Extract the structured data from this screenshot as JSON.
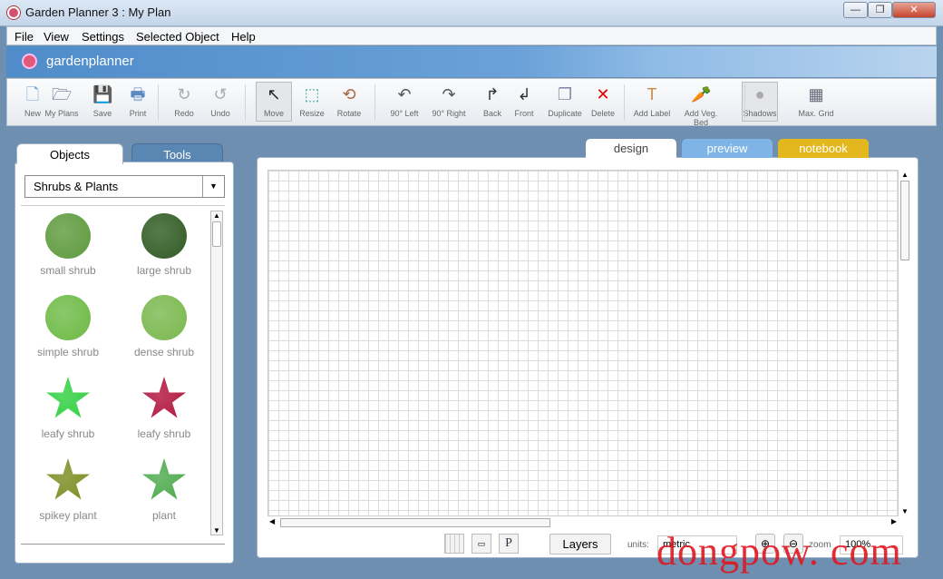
{
  "window": {
    "title": "Garden Planner 3 : My  Plan",
    "controls": [
      "minimize",
      "maximize",
      "close"
    ]
  },
  "menu": [
    "File",
    "View",
    "Settings",
    "Selected Object",
    "Help"
  ],
  "brand": "gardenplanner",
  "toolbar": [
    {
      "label": "New",
      "icon": "new-file-icon"
    },
    {
      "label": "My Plans",
      "icon": "folder-icon"
    },
    {
      "label": "Save",
      "icon": "save-icon"
    },
    {
      "label": "Print",
      "icon": "print-icon"
    },
    {
      "label": "Redo",
      "icon": "redo-icon"
    },
    {
      "label": "Undo",
      "icon": "undo-icon"
    },
    {
      "label": "Move",
      "icon": "cursor-icon"
    },
    {
      "label": "Resize",
      "icon": "resize-icon"
    },
    {
      "label": "Rotate",
      "icon": "rotate-icon"
    },
    {
      "label": "90° Left",
      "icon": "rotate-left-icon"
    },
    {
      "label": "90° Right",
      "icon": "rotate-right-icon"
    },
    {
      "label": "Back",
      "icon": "send-back-icon"
    },
    {
      "label": "Front",
      "icon": "bring-front-icon"
    },
    {
      "label": "Duplicate",
      "icon": "duplicate-icon"
    },
    {
      "label": "Delete",
      "icon": "delete-icon"
    },
    {
      "label": "Add Label",
      "icon": "text-icon"
    },
    {
      "label": "Add Veg. Bed",
      "icon": "veg-bed-icon"
    },
    {
      "label": "Shadows",
      "icon": "shadow-icon"
    },
    {
      "label": "Max. Grid",
      "icon": "grid-icon"
    }
  ],
  "left": {
    "tabs": [
      "Objects",
      "Tools"
    ],
    "category": "Shrubs & Plants",
    "items": [
      {
        "label": "small shrub",
        "color": "#5d9a3c"
      },
      {
        "label": "large shrub",
        "color": "#2f5a22"
      },
      {
        "label": "simple shrub",
        "color": "#6dba45"
      },
      {
        "label": "dense shrub",
        "color": "#7ab84e"
      },
      {
        "label": "leafy shrub",
        "color": "#2ecf3e"
      },
      {
        "label": "leafy shrub",
        "color": "#b0103a"
      },
      {
        "label": "spikey plant",
        "color": "#7a8a1e"
      },
      {
        "label": "plant",
        "color": "#4aa84a"
      }
    ]
  },
  "canvas_tabs": [
    {
      "label": "design",
      "color": "#ffffff"
    },
    {
      "label": "preview",
      "color": "#7eb4e6"
    },
    {
      "label": "notebook",
      "color": "#e3b81e"
    }
  ],
  "bottom": {
    "layers": "Layers",
    "units_label": "units:",
    "units_value": "metric",
    "zoom_label": "zoom",
    "zoom_value": "100%",
    "p_label": "P"
  },
  "watermark": "dongpow. com"
}
